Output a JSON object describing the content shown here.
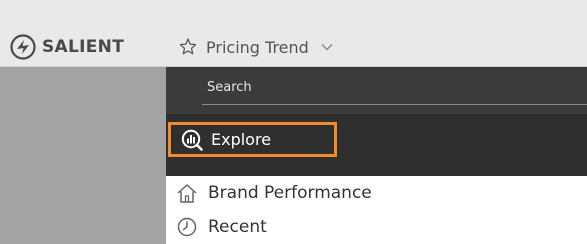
{
  "brand": {
    "name": "SALIENT",
    "icon": "salient-logo"
  },
  "header": {
    "title": "Pricing Trend",
    "star_icon": "star-outline-icon",
    "menu_icon": "chevron-down-icon"
  },
  "dropdown": {
    "search_placeholder": "Search",
    "items": [
      {
        "label": "Explore",
        "icon": "explore-icon",
        "highlighted": true
      },
      {
        "label": "Brand Performance",
        "icon": "home-icon"
      },
      {
        "label": "Recent",
        "icon": "clock-icon"
      }
    ]
  },
  "colors": {
    "highlight": "#f08c2a",
    "dropdown_dark": "#2f2f2f",
    "search_bg": "#3b3b3b",
    "backdrop": "#a3a3a3"
  }
}
